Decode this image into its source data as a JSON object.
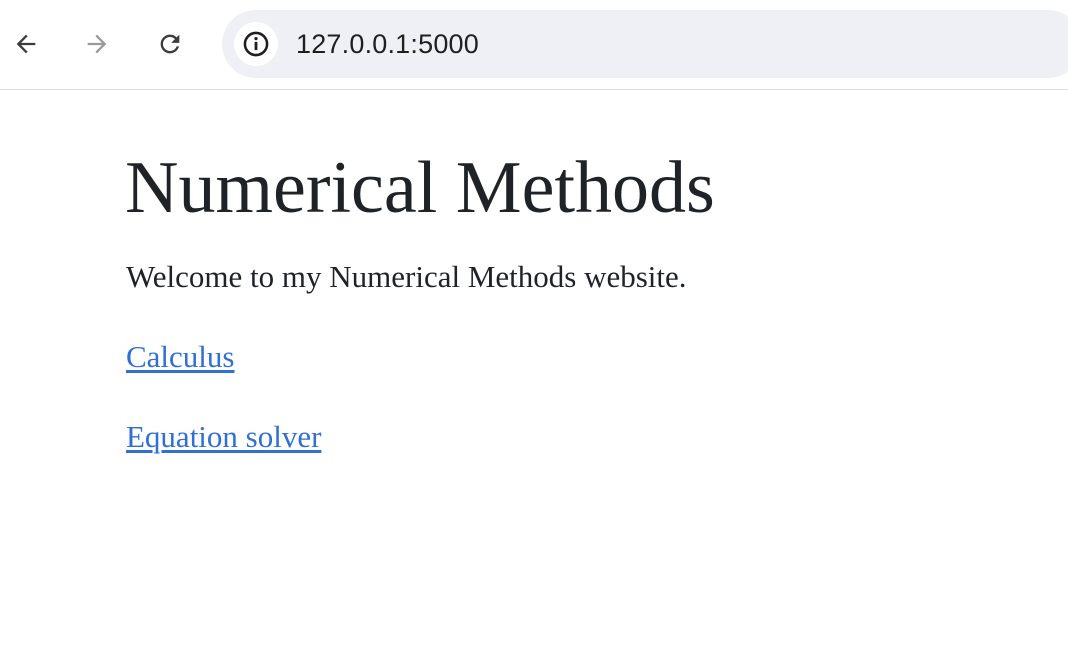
{
  "browser": {
    "address_bar": {
      "url": "127.0.0.1:5000",
      "site_info_icon": "info-icon"
    },
    "nav": {
      "back_icon": "arrow-left-icon",
      "forward_icon": "arrow-right-icon",
      "reload_icon": "reload-icon"
    }
  },
  "page": {
    "title": "Numerical Methods",
    "intro": "Welcome to my Numerical Methods website.",
    "links": [
      {
        "label": "Calculus"
      },
      {
        "label": "Equation solver"
      }
    ]
  },
  "colors": {
    "link": "#2f6fd6",
    "text": "#1f2328",
    "omnibox_bg": "#eef0f5"
  }
}
